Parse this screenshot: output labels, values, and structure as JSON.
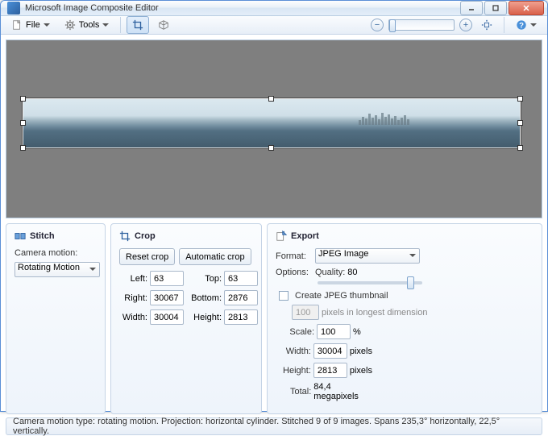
{
  "window": {
    "title": "Microsoft Image Composite Editor"
  },
  "toolbar": {
    "file": "File",
    "tools": "Tools"
  },
  "stitch": {
    "heading": "Stitch",
    "camera_label": "Camera motion:",
    "camera_value": "Rotating Motion"
  },
  "crop": {
    "heading": "Crop",
    "reset": "Reset crop",
    "auto": "Automatic crop",
    "left_label": "Left:",
    "left": "63",
    "top_label": "Top:",
    "top": "63",
    "right_label": "Right:",
    "right": "30067",
    "bottom_label": "Bottom:",
    "bottom": "2876",
    "width_label": "Width:",
    "width": "30004",
    "height_label": "Height:",
    "height": "2813"
  },
  "export": {
    "heading": "Export",
    "format_label": "Format:",
    "format_value": "JPEG Image",
    "options_label": "Options:",
    "quality_label": "Quality:",
    "quality": "80",
    "thumb_label": "Create JPEG thumbnail",
    "thumb_px": "100",
    "thumb_hint": "pixels in longest dimension",
    "scale_label": "Scale:",
    "scale": "100",
    "scale_unit": "%",
    "width_label": "Width:",
    "width": "30004",
    "px": "pixels",
    "height_label": "Height:",
    "height": "2813",
    "total_label": "Total:",
    "total": "84,4 megapixels"
  },
  "status": "Camera motion type: rotating motion. Projection: horizontal cylinder. Stitched 9 of 9 images. Spans 235,3° horizontally, 22,5° vertically."
}
